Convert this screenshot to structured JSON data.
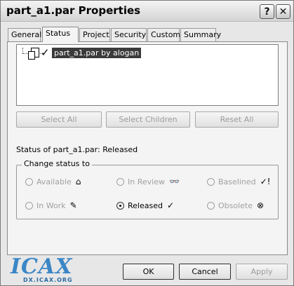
{
  "window": {
    "title": "part_a1.par Properties"
  },
  "titlebar": {
    "help_glyph": "?",
    "close_glyph": "✕"
  },
  "tabs": [
    {
      "label": "General"
    },
    {
      "label": "Status"
    },
    {
      "label": "Project"
    },
    {
      "label": "Security"
    },
    {
      "label": "Custom"
    },
    {
      "label": "Summary"
    }
  ],
  "active_tab": "Status",
  "file_list": {
    "items": [
      {
        "label": "part_a1.par by alogan",
        "status_glyph": "✓"
      }
    ]
  },
  "selection_buttons": {
    "select_all": "Select All",
    "select_children": "Select Children",
    "reset_all": "Reset All"
  },
  "status": {
    "prefix": "Status of  part_a1.par:",
    "value": "Released"
  },
  "change_status": {
    "legend": "Change status to",
    "options": [
      {
        "label": "Available",
        "glyph": "⌂",
        "selected": false,
        "enabled": false
      },
      {
        "label": "In Review",
        "glyph": "👓",
        "selected": false,
        "enabled": false
      },
      {
        "label": "Baselined",
        "glyph": "✓!",
        "selected": false,
        "enabled": false
      },
      {
        "label": "In Work",
        "glyph": "✎",
        "selected": false,
        "enabled": false
      },
      {
        "label": "Released",
        "glyph": "✓",
        "selected": true,
        "enabled": true
      },
      {
        "label": "Obsolete",
        "glyph": "⊗",
        "selected": false,
        "enabled": false
      }
    ]
  },
  "dialog_buttons": {
    "ok": "OK",
    "cancel": "Cancel",
    "apply": "Apply"
  },
  "watermark": {
    "text": "ICAX",
    "sub": "DX.ICAX.ORG"
  }
}
